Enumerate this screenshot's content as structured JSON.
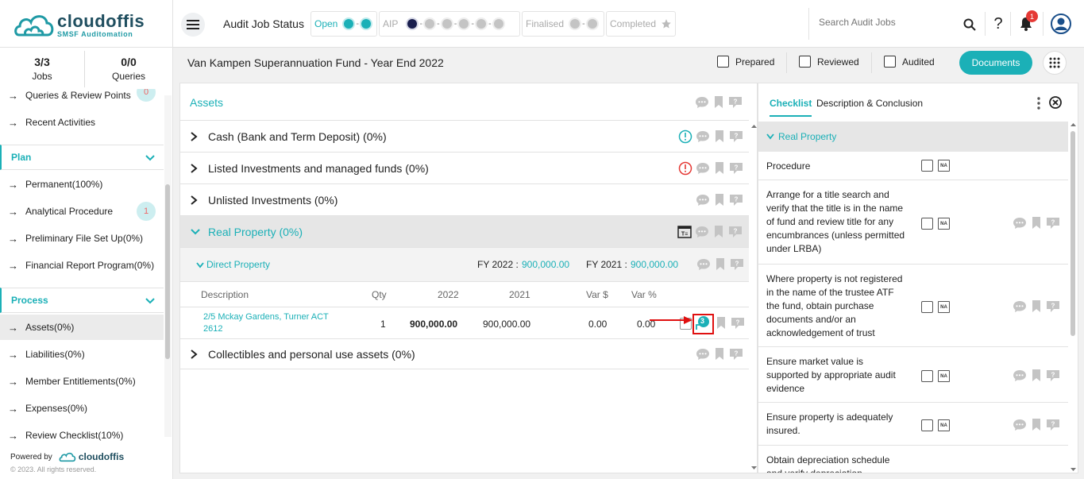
{
  "brand": {
    "name": "cloudoffis",
    "tagline": "SMSF Auditomation"
  },
  "header": {
    "audit_job_status_label": "Audit Job Status",
    "stage_open": "Open",
    "stage_aip": "AIP",
    "stage_finalised": "Finalised",
    "stage_completed": "Completed",
    "search_placeholder": "Search Audit Jobs",
    "notification_count": "1"
  },
  "sidebar": {
    "jobs_count": "3/3",
    "jobs_label": "Jobs",
    "queries_count": "0/0",
    "queries_label": "Queries",
    "top_items": [
      {
        "label": "Queries & Review Points",
        "badge": "0"
      },
      {
        "label": "Recent Activities"
      }
    ],
    "plan_label": "Plan",
    "plan_items": [
      {
        "label": "Permanent(100%)"
      },
      {
        "label": "Analytical Procedure",
        "badge": "1"
      },
      {
        "label": "Preliminary File Set Up(0%)"
      },
      {
        "label": "Financial Report Program(0%)"
      }
    ],
    "process_label": "Process",
    "process_items": [
      {
        "label": "Assets(0%)"
      },
      {
        "label": "Liabilities(0%)"
      },
      {
        "label": "Member Entitlements(0%)"
      },
      {
        "label": "Expenses(0%)"
      },
      {
        "label": "Review Checklist(10%)"
      }
    ],
    "powered_by": "Powered by",
    "powered_brand": "cloudoffis",
    "copyright": "© 2023. All rights reserved."
  },
  "job": {
    "title": "Van Kampen Superannuation Fund - Year End 2022",
    "prepared_label": "Prepared",
    "reviewed_label": "Reviewed",
    "audited_label": "Audited",
    "documents_label": "Documents"
  },
  "main": {
    "section_title": "Assets",
    "rows": [
      {
        "label": "Cash (Bank and Term Deposit) (0%)"
      },
      {
        "label": "Listed Investments and managed funds (0%)"
      },
      {
        "label": "Unlisted Investments (0%)"
      },
      {
        "label": "Real Property (0%)"
      },
      {
        "label": "Collectibles and personal use assets (0%)"
      }
    ],
    "sub_section": "Direct Property",
    "fy2022_label": "FY 2022 :",
    "fy2022_value": "900,000.00",
    "fy2021_label": "FY 2021 :",
    "fy2021_value": "900,000.00",
    "table_headers": [
      "Description",
      "Qty",
      "2022",
      "2021",
      "Var $",
      "Var %"
    ],
    "table_row": {
      "description": "2/5 Mckay Gardens, Turner ACT 2612",
      "qty": "1",
      "y2022": "900,000.00",
      "y2021": "900,000.00",
      "var_amount": "0.00",
      "var_pct": "0.00",
      "comment_count": "3"
    }
  },
  "right": {
    "tab_checklist": "Checklist",
    "tab_description": "Description & Conclusion",
    "section": "Real Property",
    "procedure_header": "Procedure",
    "na_label": "NA",
    "procedures": [
      "Arrange for a title search and verify that the title is in the name of fund and review title for any encumbrances (unless permitted under LRBA)",
      "Where property is not registered in the name of the trustee ATF the fund, obtain purchase documents and/or an acknowledgement of trust",
      "Ensure market value is supported by appropriate audit evidence",
      "Ensure property is adequately insured.",
      "Obtain depreciation schedule and verify depreciation"
    ]
  },
  "colors": {
    "accent": "#1bb0b7",
    "dark_navy": "#1a1f4e",
    "alert_red": "#e53935",
    "icon_grey": "#c4c4c4"
  }
}
